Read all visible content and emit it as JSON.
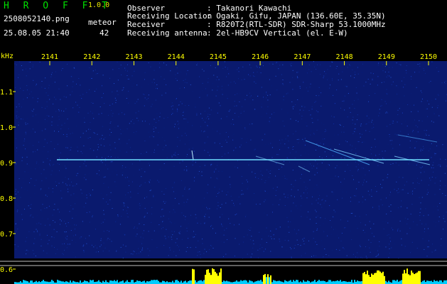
{
  "app": {
    "name": "H R O F F T",
    "version": "1.0.0"
  },
  "file": {
    "name": "2508052140.png",
    "datetime": "25.08.05 21:40"
  },
  "meteor": {
    "label": "meteor",
    "count": "42"
  },
  "info": [
    {
      "label": "Observer",
      "value": ": Takanori Kawachi"
    },
    {
      "label": "Receiving Location",
      "value": ": Ogaki, Gifu, JAPAN (136.60E, 35.35N)"
    },
    {
      "label": "Receiver",
      "value": ": R820T2(RTL-SDR) SDR-Sharp 53.1000MHz"
    },
    {
      "label": "Receiving antenna",
      "value": ": 2el-HB9CV Vertical (el. E-W)"
    }
  ],
  "axis": {
    "unit": "kHz",
    "time_ticks": [
      "2141",
      "2142",
      "2143",
      "2144",
      "2145",
      "2146",
      "2147",
      "2148",
      "2149",
      "2150"
    ],
    "freq_ticks": [
      "1.1",
      "1.0",
      "0.9",
      "0.8",
      "0.7",
      "0.6"
    ]
  },
  "colors": {
    "background": "#000000",
    "noise": "#0a1a6e",
    "carrier": "#6fe0ff",
    "tick_label": "#ffff00",
    "level_bar": "#00ccff",
    "level_peak": "#ffff00"
  }
}
